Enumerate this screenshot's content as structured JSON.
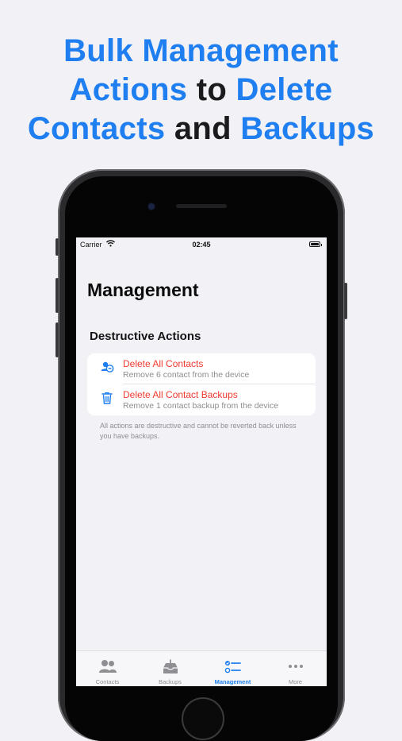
{
  "headline": {
    "line1": {
      "a": "Bulk Management"
    },
    "line2": {
      "a": "Actions",
      "b": " to ",
      "c": "Delete"
    },
    "line3": {
      "a": "Contacts",
      "b": " and ",
      "c": "Backups"
    }
  },
  "colors": {
    "accent": "#1f7ff0",
    "destructive": "#f03a2e",
    "secondary_text": "#8e8e93"
  },
  "status_bar": {
    "carrier": "Carrier",
    "time": "02:45"
  },
  "screen": {
    "title": "Management",
    "section_header": "Destructive Actions",
    "actions": [
      {
        "title": "Delete All Contacts",
        "subtitle": "Remove 6 contact from the device",
        "icon": "delete-contacts-icon"
      },
      {
        "title": "Delete All Contact Backups",
        "subtitle": "Remove 1 contact backup from the device",
        "icon": "trash-icon"
      }
    ],
    "footnote": "All actions are destructive and cannot be reverted back unless you have backups."
  },
  "tabbar": {
    "tabs": [
      {
        "label": "Contacts",
        "icon": "contacts-icon",
        "active": false
      },
      {
        "label": "Backups",
        "icon": "backups-icon",
        "active": false
      },
      {
        "label": "Management",
        "icon": "management-icon",
        "active": true
      },
      {
        "label": "More",
        "icon": "more-icon",
        "active": false
      }
    ]
  }
}
